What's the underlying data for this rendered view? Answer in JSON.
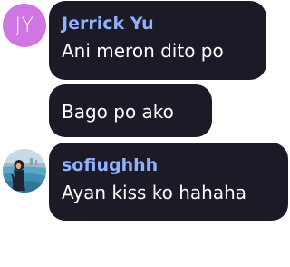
{
  "messages": [
    {
      "sender": "Jerrick Yu",
      "avatar_initials": "JY",
      "avatar_color": "#cf76e3",
      "text": "Ani meron dito po"
    },
    {
      "sender": "",
      "text": "Bago po ako"
    },
    {
      "sender": "sofiughhh",
      "avatar_type": "photo",
      "text": "Ayan kiss ko hahaha"
    }
  ],
  "colors": {
    "bubble": "#1c1a27",
    "sender_name": "#8fb1ff",
    "message_text": "#ffffff",
    "background": "#ffffff"
  }
}
